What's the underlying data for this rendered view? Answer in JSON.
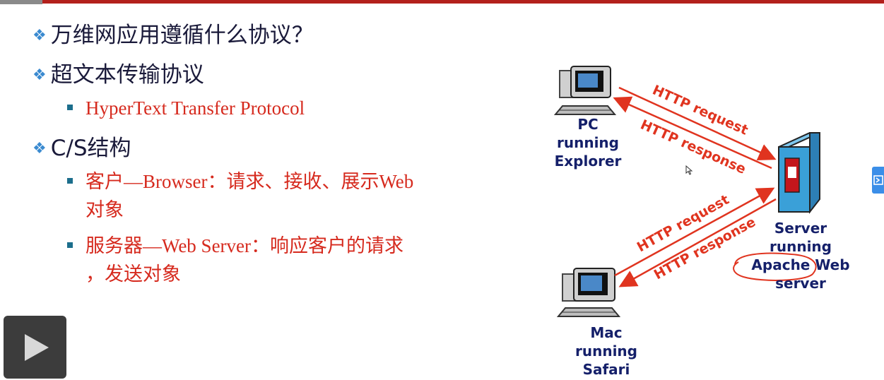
{
  "slide": {
    "bullets": {
      "q1": "万维网应用遵循什么协议？",
      "q2": "超文本传输协议",
      "q2_sub": "HyperText Transfer Protocol",
      "q3": "C/S结构",
      "q3_sub1_line1": "客户—Browser：请求、接收、展示Web",
      "q3_sub1_line2": "对象",
      "q3_sub2_line1": "服务器—Web Server：响应客户的请求",
      "q3_sub2_line2": "，发送对象"
    },
    "diagram": {
      "pc_label_line1": "PC running",
      "pc_label_line2": "Explorer",
      "mac_label_line1": "Mac running",
      "mac_label_line2": "Safari",
      "server_label_line1": "Server",
      "server_label_line2": "running",
      "server_label_line3": "Apache Web",
      "server_label_line4": "server",
      "arrow_pc_request": "HTTP request",
      "arrow_pc_response": "HTTP response",
      "arrow_mac_request": "HTTP request",
      "arrow_mac_response": "HTTP response"
    }
  },
  "colors": {
    "accent_red": "#d62a1e",
    "label_navy": "#15206a",
    "bullet_blue": "#3a8ad0",
    "server_blue": "#3aa0d8",
    "play_bg": "#3c3c3c"
  },
  "icons": {
    "play": "play-icon",
    "computer": "computer-icon",
    "server": "server-icon",
    "cursor": "mouse-cursor-icon"
  }
}
